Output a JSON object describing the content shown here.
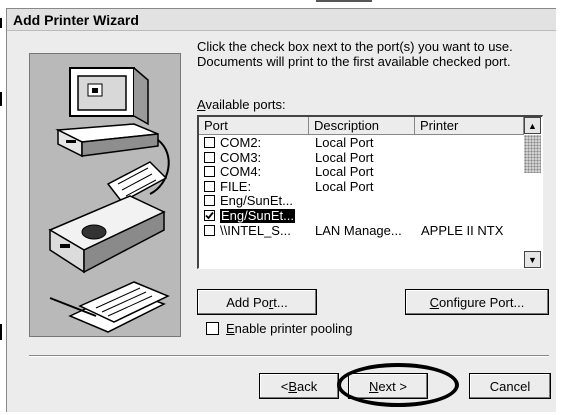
{
  "window": {
    "title": "Add Printer Wizard"
  },
  "instructions": {
    "line1": "Click the check box next to the port(s) you want to use.",
    "line2": "Documents will print to the first available checked port."
  },
  "ports": {
    "label_accel": "A",
    "label_rest": "vailable ports:",
    "columns": [
      "Port",
      "Description",
      "Printer"
    ],
    "rows": [
      {
        "checked": false,
        "port": "COM2:",
        "description": "Local Port",
        "printer": ""
      },
      {
        "checked": false,
        "port": "COM3:",
        "description": "Local Port",
        "printer": ""
      },
      {
        "checked": false,
        "port": "COM4:",
        "description": "Local Port",
        "printer": ""
      },
      {
        "checked": false,
        "port": "FILE:",
        "description": "Local Port",
        "printer": ""
      },
      {
        "checked": false,
        "port": "Eng/SunEt...",
        "description": "",
        "printer": ""
      },
      {
        "checked": true,
        "selected": true,
        "port": "Eng/SunEt...",
        "description": "",
        "printer": ""
      },
      {
        "checked": false,
        "port": "\\\\INTEL_S...",
        "description": "LAN Manage...",
        "printer": "APPLE II NTX"
      }
    ]
  },
  "buttons": {
    "add_port": {
      "before": "Add Po",
      "accel": "r",
      "after": "t..."
    },
    "configure_port": {
      "before": "",
      "accel": "C",
      "after": "onfigure Port..."
    },
    "back": {
      "before": "< ",
      "accel": "B",
      "after": "ack"
    },
    "next": {
      "before": "",
      "accel": "N",
      "after": "ext >"
    },
    "cancel": "Cancel"
  },
  "pooling": {
    "checked": false,
    "accel": "E",
    "rest": "nable printer pooling"
  },
  "icons": {
    "illustration": "computer-printer-illustration",
    "scroll_up": "arrow-up-icon",
    "scroll_down": "arrow-down-icon"
  },
  "colors": {
    "window_bg": "#ececec",
    "illustration_bg": "#b9b9b9",
    "selection": "#000000"
  }
}
